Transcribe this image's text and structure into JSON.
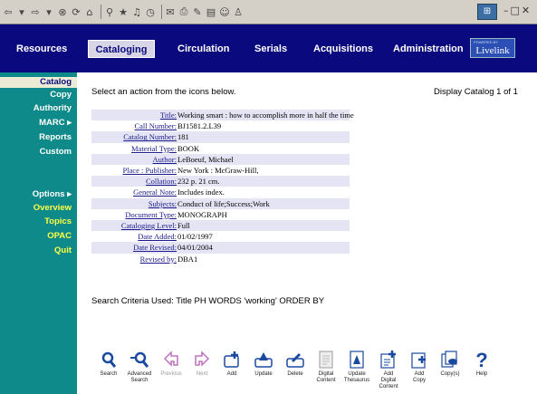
{
  "nav": {
    "items": [
      "Resources",
      "Cataloging",
      "Circulation",
      "Serials",
      "Acquisitions",
      "Administration"
    ],
    "active": "Cataloging",
    "logo_top": "POWERED BY",
    "logo": "Livelink"
  },
  "sidebar": {
    "items": [
      "Catalog",
      "Copy",
      "Authority",
      "MARC ▸",
      "Reports",
      "Custom",
      "Options ▸",
      "Overview",
      "Topics",
      "OPAC",
      "Quit"
    ]
  },
  "main": {
    "instruction": "Select an action from the icons below.",
    "display": "Display Catalog  1 of 1",
    "search_criteria": "Search Criteria Used: Title  PH WORDS 'working'  ORDER BY"
  },
  "record": [
    {
      "label": "Title:",
      "value": "Working smart : how to accomplish more in half the time"
    },
    {
      "label": "Call Number:",
      "value": "BJ1581.2.L39"
    },
    {
      "label": "Catalog Number:",
      "value": "181"
    },
    {
      "label": "Material Type:",
      "value": "BOOK"
    },
    {
      "label": "Author:",
      "value": "LeBoeuf, Michael"
    },
    {
      "label": "Place : Publisher:",
      "value": "New York : McGraw-Hill,"
    },
    {
      "label": "Collation:",
      "value": "232 p. 21 cm."
    },
    {
      "label": "General Note:",
      "value": "Includes index."
    },
    {
      "label": "Subjects:",
      "value": "Conduct of life;Success;Work"
    },
    {
      "label": "Document Type:",
      "value": "MONOGRAPH"
    },
    {
      "label": "Cataloging Level:",
      "value": "Full"
    },
    {
      "label": "Date Added:",
      "value": "01/02/1997"
    },
    {
      "label": "Date Revised:",
      "value": "04/01/2004"
    },
    {
      "label": "Revised by:",
      "value": "DBA1"
    }
  ],
  "toolbar": [
    {
      "label": "Search",
      "icon": "search-icon"
    },
    {
      "label": "Advanced\nSearch",
      "icon": "advanced-search-icon"
    },
    {
      "label": "Previous",
      "icon": "previous-icon",
      "disabled": true
    },
    {
      "label": "Next",
      "icon": "next-icon",
      "disabled": true
    },
    {
      "label": "Add",
      "icon": "add-icon"
    },
    {
      "label": "Update",
      "icon": "update-icon"
    },
    {
      "label": "Delete",
      "icon": "delete-icon"
    },
    {
      "label": "Digital\nContent",
      "icon": "digital-content-icon"
    },
    {
      "label": "Update\nThesaurus",
      "icon": "update-thesaurus-icon"
    },
    {
      "label": "Add\nDigital\nContent",
      "icon": "add-digital-content-icon"
    },
    {
      "label": "Add\nCopy",
      "icon": "add-copy-icon"
    },
    {
      "label": "Copy(s)",
      "icon": "copys-icon"
    },
    {
      "label": "Help",
      "icon": "help-icon"
    }
  ],
  "colors": {
    "nav_bg": "#0a0a7e",
    "sidebar_bg": "#0f8a8a",
    "icon": "#1a4aa0"
  }
}
